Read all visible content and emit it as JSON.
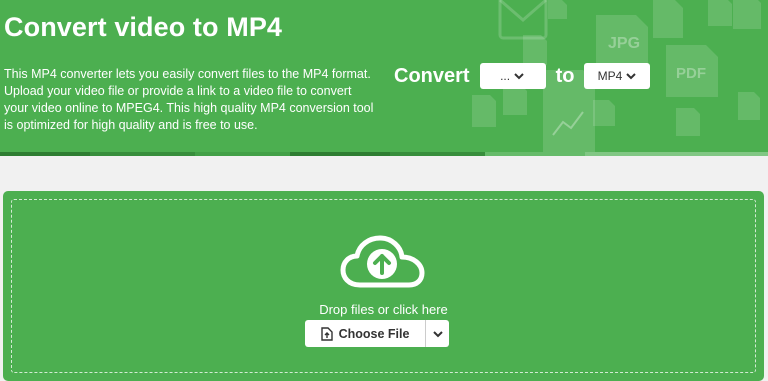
{
  "header": {
    "title": "Convert video to MP4",
    "description": "This MP4 converter lets you easily convert files to the MP4 format. Upload your video file or provide a link to a video file to convert your video online to MPEG4. This high quality MP4 conversion tool is optimized for high quality and is free to use."
  },
  "converter": {
    "convert_label": "Convert",
    "from_value": "...",
    "to_label": "to",
    "to_value": "MP4"
  },
  "background_icons": [
    "envelope-icon",
    "jpg-file-icon",
    "pdf-file-icon",
    "image-file-icon",
    "chart-file-icon",
    "document-icon"
  ],
  "background_icon_labels": {
    "jpg": "JPG",
    "pdf": "PDF"
  },
  "dropzone": {
    "prompt": "Drop files or click here",
    "choose_label": "Choose File"
  },
  "colors": {
    "primary_green": "#4caf50",
    "page_background": "#f1f1f1"
  }
}
